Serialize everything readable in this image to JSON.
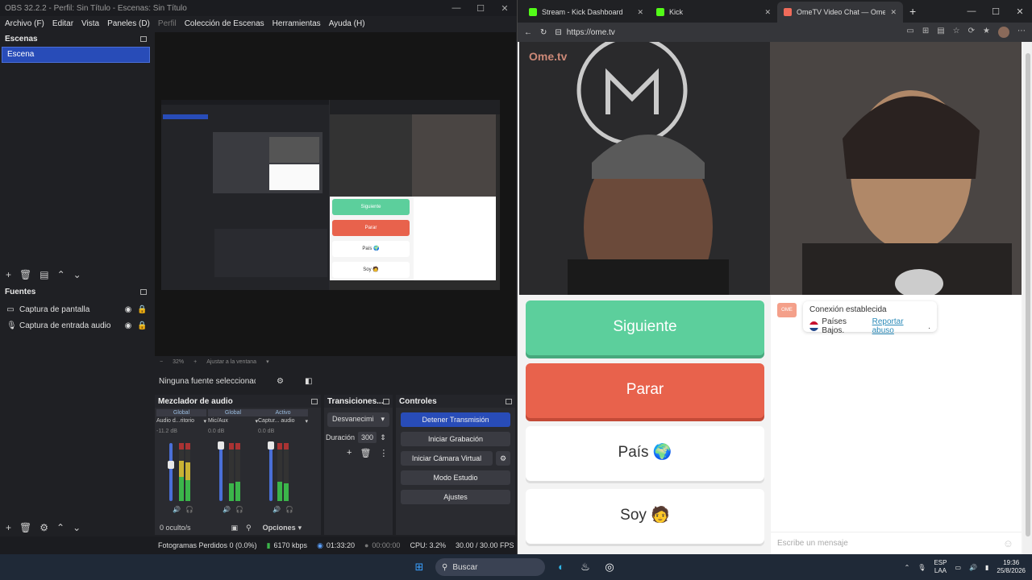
{
  "obs": {
    "title": "OBS 32.2.2 - Perfil: Sin Título - Escenas: Sin Título",
    "menu": [
      "Archivo (F)",
      "Editar",
      "Vista",
      "Paneles (D)",
      "Perfil",
      "Colección de Escenas",
      "Herramientas",
      "Ayuda (H)"
    ],
    "scenes": {
      "title": "Escenas",
      "items": [
        "Escena"
      ]
    },
    "sources": {
      "title": "Fuentes",
      "items": [
        {
          "label": "Captura de pantalla",
          "icon": "monitor-icon"
        },
        {
          "label": "Captura de entrada audio",
          "icon": "microphone-icon"
        }
      ]
    },
    "preview_bar": {
      "zoom": "32%",
      "fit_label": "Ajustar a la ventana"
    },
    "no_source": "Ninguna fuente seleccionad",
    "mixer": {
      "title": "Mezclador de audio",
      "channels": [
        {
          "tag": "Global",
          "name": "Audio d...ritorio",
          "db": "-11.2 dB"
        },
        {
          "tag": "Global",
          "name": "Mic/Aux",
          "db": "0.0 dB"
        },
        {
          "tag": "Activo",
          "name": "Captur... audio",
          "db": "0.0 dB"
        }
      ],
      "hidden": "0 oculto/s",
      "options": "Opciones"
    },
    "transitions": {
      "title": "Transiciones...",
      "selected": "Desvanecimi",
      "duration_label": "Duración",
      "duration_value": "300"
    },
    "controls": {
      "title": "Controles",
      "stop_stream": "Detener Transmisión",
      "start_record": "Iniciar Grabación",
      "virtual_cam": "Iniciar Cámara Virtual",
      "studio": "Modo Estudio",
      "settings": "Ajustes"
    },
    "status": {
      "dropped": "Fotogramas Perdidos 0 (0.0%)",
      "bitrate": "6170 kbps",
      "stream_time": "01:33:20",
      "rec_time": "00:00:00",
      "cpu": "CPU: 3.2%",
      "fps": "30.00 / 30.00 FPS"
    },
    "canvas": {
      "next": "Siguiente",
      "stop": "Parar",
      "country": "País 🌍",
      "me": "Soy 🧑"
    }
  },
  "browser": {
    "tabs": [
      {
        "title": "Stream - Kick Dashboard",
        "color": "#53fc18"
      },
      {
        "title": "Kick",
        "color": "#53fc18"
      },
      {
        "title": "OmeTV Video Chat — Omegl",
        "color": "#f06b5a"
      }
    ],
    "url": "https://ome.tv",
    "logo": "Ome.tv",
    "buttons": {
      "next": "Siguiente",
      "stop": "Parar",
      "country": "País 🌍",
      "me": "Soy 🧑"
    },
    "chat": {
      "status": "Conexión establecida",
      "country": "Países Bajos.",
      "report": "Reportar abuso",
      "placeholder": "Escribe un mensaje"
    }
  },
  "taskbar": {
    "search": "Buscar",
    "lang": [
      "ESP",
      "LAA"
    ],
    "time": "19:36",
    "date": "25/8/2026"
  },
  "colors": {
    "accent": "#284cb8",
    "next": "#5ccf9c",
    "stop": "#e8624c"
  }
}
